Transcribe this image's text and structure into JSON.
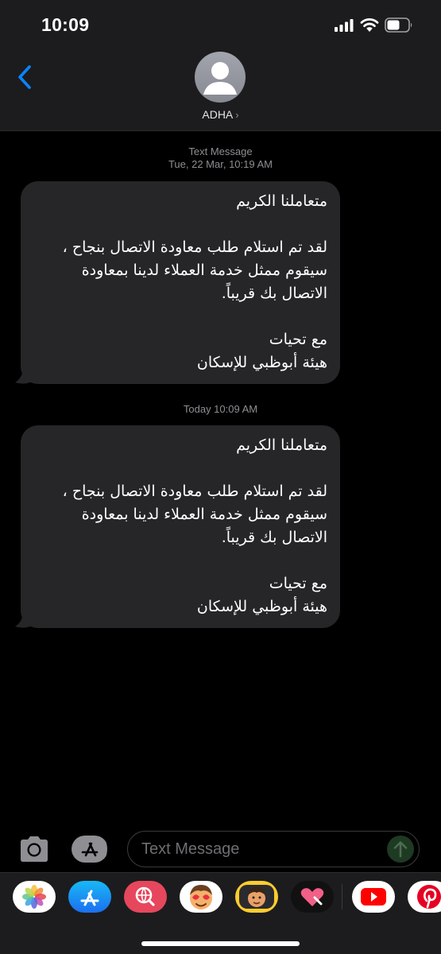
{
  "status": {
    "time": "10:09"
  },
  "header": {
    "contact_name": "ADHA",
    "chevron": "›"
  },
  "thread": [
    {
      "stamp_line1": "Text Message",
      "stamp_line2": "Tue, 22 Mar, 10:19 AM",
      "text": "متعاملنا الكريم\n\nلقد تم استلام طلب معاودة الاتصال بنجاح ، سيقوم ممثل خدمة العملاء لدينا بمعاودة الاتصال بك قريباً.\n\nمع تحيات\nهيئة أبوظبي للإسكان"
    },
    {
      "stamp_line1": "Today 10:09 AM",
      "text": "متعاملنا الكريم\n\nلقد تم استلام طلب معاودة الاتصال بنجاح ، سيقوم ممثل خدمة العملاء لدينا بمعاودة الاتصال بك قريباً.\n\nمع تحيات\nهيئة أبوظبي للإسكان"
    }
  ],
  "input": {
    "placeholder": "Text Message"
  },
  "app_strip": [
    "photos-icon",
    "app-store-icon",
    "web-search-icon",
    "memoji-stickers-icon",
    "animoji-icon",
    "digital-touch-icon",
    "youtube-icon",
    "pinterest-icon"
  ],
  "colors": {
    "background": "#000000",
    "bar": "#1c1c1e",
    "bubble": "#262628",
    "accent": "#0a84ff",
    "stamp": "#8e8e93"
  }
}
